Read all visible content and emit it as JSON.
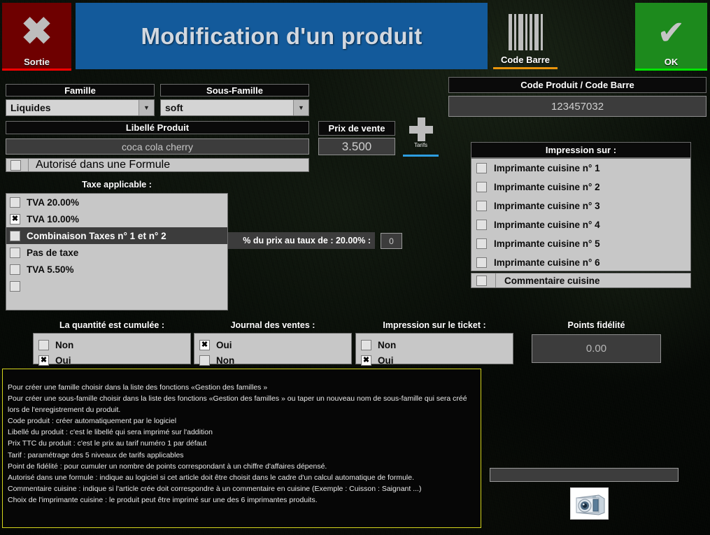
{
  "window": {
    "title": "Modification d'un produit"
  },
  "toolbar": {
    "exit": {
      "label": "Sortie",
      "icon": "close-x-icon",
      "color": "#6e0000"
    },
    "barcode": {
      "label": "Code Barre",
      "icon": "barcode-icon",
      "accent": "#e8940c"
    },
    "ok": {
      "label": "OK",
      "icon": "check-icon",
      "color": "#1d8a1d"
    }
  },
  "form": {
    "famille": {
      "label": "Famille",
      "value": "Liquides"
    },
    "sous_famille": {
      "label": "Sous-Famille",
      "value": "soft"
    },
    "libelle": {
      "label": "Libellé Produit",
      "value": "coca cola cherry"
    },
    "prix_vente": {
      "label": "Prix de vente",
      "value": "3.500"
    },
    "tarifs": {
      "label": "Tarifs",
      "icon": "plus-icon",
      "accent": "#2d9de0"
    },
    "formule": {
      "label": "Autorisé dans une Formule",
      "checked": false
    }
  },
  "taxes": {
    "label": "Taxe applicable :",
    "items": [
      {
        "label": "TVA 20.00%",
        "checked": false,
        "highlight": false
      },
      {
        "label": "TVA 10.00%",
        "checked": true,
        "highlight": false
      },
      {
        "label": "Combinaison Taxes n° 1 et n° 2",
        "checked": false,
        "highlight": true
      },
      {
        "label": "Pas de taxe",
        "checked": false,
        "highlight": false
      },
      {
        "label": "TVA 5.50%",
        "checked": false,
        "highlight": false
      },
      {
        "label": "",
        "checked": false,
        "highlight": false
      }
    ],
    "combination": {
      "label": "% du prix au taux de : 20.00% :",
      "value": "0"
    }
  },
  "code_produit": {
    "label": "Code Produit / Code Barre",
    "value": "123457032"
  },
  "impression": {
    "label": "Impression sur :",
    "items": [
      {
        "label": "Imprimante cuisine n° 1",
        "checked": false
      },
      {
        "label": "Imprimante cuisine n° 2",
        "checked": false
      },
      {
        "label": "Imprimante cuisine n° 3",
        "checked": false
      },
      {
        "label": "Imprimante cuisine n° 4",
        "checked": false
      },
      {
        "label": "Imprimante cuisine n° 5",
        "checked": false
      },
      {
        "label": "Imprimante cuisine n° 6",
        "checked": false
      }
    ],
    "commentaire": {
      "label": "Commentaire cuisine",
      "checked": false
    }
  },
  "options": {
    "quantite": {
      "label": "La quantité est cumulée :",
      "items": [
        {
          "label": "Non",
          "checked": false
        },
        {
          "label": "Oui",
          "checked": true
        }
      ]
    },
    "journal": {
      "label": "Journal des ventes :",
      "items": [
        {
          "label": "Oui",
          "checked": true
        },
        {
          "label": "Non",
          "checked": false
        }
      ]
    },
    "ticket": {
      "label": "Impression sur le  ticket :",
      "items": [
        {
          "label": "Non",
          "checked": false
        },
        {
          "label": "Oui",
          "checked": true
        }
      ]
    },
    "fidelite": {
      "label": "Points fidélité",
      "value": "0.00"
    }
  },
  "help": {
    "lines": [
      "Pour créer une famille choisir dans la liste des fonctions «Gestion des familles »",
      "Pour créer une sous-famille choisir dans la liste des fonctions «Gestion des familles » ou taper un nouveau nom de sous-famille qui sera créé lors de l'enregistrement du produit.",
      "Code produit : créer automatiquement par le logiciel",
      "Libellé du produit : c'est le libellé qui sera imprimé sur l'addition",
      "Prix TTC du produit : c'est le prix au tarif numéro 1 par défaut",
      "Tarif : paramétrage des 5 niveaux de tarifs applicables",
      "Point de fidélité : pour cumuler un nombre de points correspondant à un chiffre d'affaires dépensé.",
      "Autorisé dans une formule : indique au logiciel si cet article doit être choisit dans le cadre d'un calcul automatique de formule.",
      "Commentaire cuisine : indique si l'article crée doit correspondre à un commentaire en cuisine (Exemple : Cuisson : Saignant ...)",
      "Choix de l'imprimante cuisine : le produit peut être imprimé sur une des 6 imprimantes produits."
    ]
  },
  "media": {
    "image_path": "",
    "camera_button": {
      "icon": "camera-icon"
    }
  },
  "checkmark_glyph": "✖"
}
